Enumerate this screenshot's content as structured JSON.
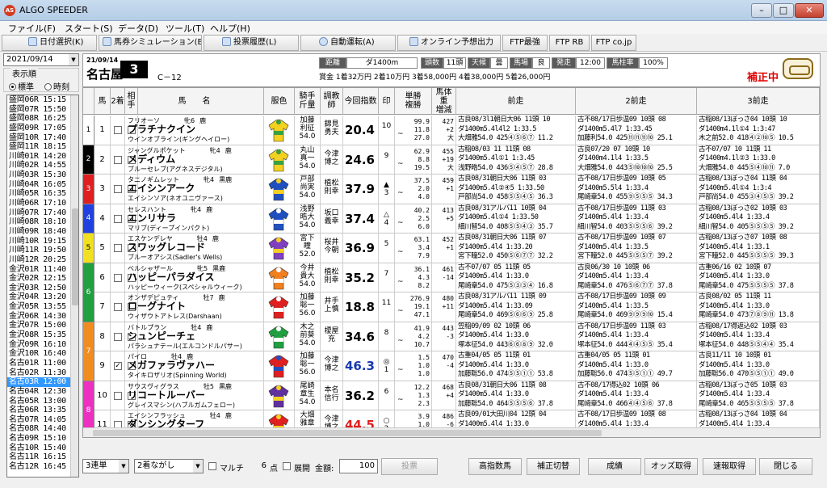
{
  "window": {
    "title": "ALGO SPEEDER",
    "app_icon_text": "AS",
    "minimize": "–",
    "maximize": "□",
    "close": "✕"
  },
  "menu": [
    "ファイル(F)",
    "スタート(S)",
    "データ(D)",
    "ツール(T)",
    "ヘルプ(H)"
  ],
  "toolbar": [
    "日付選択(K)",
    "馬券シミュレーション(B)",
    "投票履歴(L)",
    "自動運転(A)",
    "オンライン予想出力",
    "FTP最強",
    "FTP RB",
    "FTP co.jp"
  ],
  "left": {
    "date": "2021/09/14",
    "display_order_label": "表示順",
    "radio_standard": "標準",
    "radio_time": "時刻",
    "races": [
      "盛岡06R 15:15",
      "盛岡07R 15:50",
      "盛岡08R 16:25",
      "盛岡09R 17:05",
      "盛岡10R 17:40",
      "盛岡11R 18:15",
      "川崎01R 14:20",
      "川崎02R 14:55",
      "川崎03R 15:30",
      "川崎04R 16:05",
      "川崎05R 16:35",
      "川崎06R 17:10",
      "川崎07R 17:40",
      "川崎08R 18:10",
      "川崎09R 18:40",
      "川崎10R 19:15",
      "川崎11R 19:50",
      "川崎12R 20:25",
      "金沢01R 11:40",
      "金沢02R 12:15",
      "金沢03R 12:50",
      "金沢04R 13:20",
      "金沢05R 13:55",
      "金沢06R 14:30",
      "金沢07R 15:00",
      "金沢08R 15:35",
      "金沢09R 16:10",
      "金沢10R 16:40",
      "名古01R 11:00",
      "名古02R 11:30",
      "名古03R 12:00",
      "名古04R 12:30",
      "名古05R 13:00",
      "名古06R 13:35",
      "名古07R 14:05",
      "名古08R 14:40",
      "名古09R 15:10",
      "名古10R 15:40",
      "名古11R 16:15",
      "名古12R 16:45"
    ],
    "selected_index": 30
  },
  "header": {
    "date": "21/09/14",
    "venue": "名古屋",
    "race_no": "3",
    "class": "C－12",
    "distance_label": "距離",
    "distance": "ダ1400m",
    "count_label": "頭数",
    "count": "11頭",
    "weather_label": "天候",
    "weather": "曇",
    "track_label": "馬場",
    "track": "良",
    "post_label": "発走",
    "post_time": "12:00",
    "fav_label": "馬柱率",
    "fav_rate": "100%",
    "prize": "賞金 1着32万円 2着10万円 3着58,000円 4着38,000円 5着26,000円",
    "hosei": "補正中"
  },
  "columns": [
    "馬",
    "2着",
    "相手",
    "馬　　名",
    "服色",
    "騎手\n斤量",
    "調教\n師",
    "今回指数",
    "印",
    "単勝\n複勝",
    "馬体重\n増減",
    "前走",
    "2前走",
    "3前走"
  ],
  "horses": [
    {
      "waku": "1",
      "wcolor": "#ffffff",
      "wtext": "#000",
      "no": "1",
      "c2": false,
      "opp": false,
      "sire": "フリオーソ",
      "sex": "牝6",
      "color": "鹿",
      "name": "プラチナクイン",
      "pedigree": "ウインオブライン(ギングヘイロー)",
      "jockey": "加藤\n利征\n54.0",
      "trainer": "錦見\n勇夫",
      "index": "20.4",
      "icolor": "#000",
      "mark": "",
      "rank": "10",
      "tan": "99.9\n11.8\n27.0",
      "wt": "427\n+2\n大",
      "silk": [
        "#f4d020",
        "#3aa040"
      ],
      "p1": [
        "古良08/3l1朝日大06 11頭 10",
        "ダ1400m5.4l4l2 1:33.5",
        "大畑雅54.0 425④⑤⑥⑦ 11.2"
      ],
      "p2": [
        "古不08/17日歩温09 10頭 08",
        "ダ1400m5.4l7 1:33.45",
        "加藤利54.0 425⑪⑪⑪⑩ 25.1"
      ],
      "p3": [
        "古稲08/13ぼっさ04 10頭 10",
        "ダ1400m4.1l①4 1:3:47",
        "木之前52.0 418④②⑩⑤ 10.5"
      ]
    },
    {
      "waku": "2",
      "wcolor": "#000000",
      "wtext": "#fff",
      "no": "2",
      "c2": false,
      "opp": false,
      "sire": "ジャングルポケット",
      "sex": "牝4",
      "color": "鹿",
      "name": "メディウム",
      "pedigree": "ブルーセレブ(アグネスデジタル)",
      "jockey": "丸山\n真一\n54.0",
      "trainer": "今津\n博之",
      "index": "24.6",
      "icolor": "#000",
      "mark": "",
      "rank": "9",
      "tan": "62.9\n8.8\n19.5",
      "wt": "455\n+19\n大",
      "silk": [
        "#f4d020",
        "#3aa040"
      ],
      "p1": [
        "古稲08/03 11 11頭 08",
        "ダ1400m5.4l①1 1:3.45",
        "浅野晧54.0 436⑤④⑤⑦ 28.8"
      ],
      "p2": [
        "古良07/20 07 10頭 10",
        "ダ1400m4.1l4 1:33.5",
        "大畑雅54.0 443⑤⑩⑩⑩ 25.5"
      ],
      "p3": [
        "古不07/07 10 11頭 11",
        "ダ1400m4.1l②3 1:33.0",
        "大畑雅54.0 445⑤④⑩⑪ 7.0"
      ]
    },
    {
      "waku": "3",
      "wcolor": "#e02020",
      "wtext": "#fff",
      "no": "3",
      "c2": false,
      "opp": true,
      "sire": "タニノギムレット",
      "sex": "牝4",
      "color": "黒鹿",
      "name": "エイシンアーク",
      "pedigree": "エイシンソア(ネオユニヴァース)",
      "jockey": "戸部\n尚実\n54.0",
      "trainer": "植松\n則幸",
      "index": "37.9",
      "icolor": "#000",
      "mark": "▲",
      "rank": "3",
      "tan": "37.5\n2.0\n4.0",
      "wt": "459\n+1\n",
      "silk": [
        "#2050c0",
        "#f4d020"
      ],
      "p1": [
        "古良08/31朝日大06 11頭 03",
        "ダ1400m5.4l②④5 1:33.50",
        "戸部尚54.0 458⑤⑤④⑤ 36.3"
      ],
      "p2": [
        "古不08/17日歩温09 10頭 05",
        "ダ1400m5.5l4 1:33.4",
        "尾崎章54.0 455⑨⑤⑤⑤ 34.3"
      ],
      "p3": [
        "古稲08/13ぼっさ04 11頭 04",
        "ダ1400m5.4l①4 1:3:4",
        "戸部尚54.0 455③④⑤⑤ 39.2"
      ]
    },
    {
      "waku": "4",
      "wcolor": "#2040e0",
      "wtext": "#fff",
      "no": "4",
      "c2": false,
      "opp": true,
      "sire": "セレスハント",
      "sex": "牝4",
      "color": "鹿",
      "name": "エンリサラ",
      "pedigree": "マリブ(ディープインパクト)",
      "jockey": "浅野\n晧大\n54.0",
      "trainer": "坂口\n義幸",
      "index": "37.4",
      "icolor": "#000",
      "mark": "△",
      "rank": "4",
      "tan": "40.2\n2.5\n6.0",
      "wt": "413\n+5\n",
      "silk": [
        "#2050c0",
        "#ffffff"
      ],
      "p1": [
        "古良08/31アルバ11 10頭 04",
        "ダ1400m5.4l①4 1:33.50",
        "細川智54.0 408⑤⑤④③ 35.7"
      ],
      "p2": [
        "古不08/17日歩温09 11頭 03",
        "ダ1400m5.4l4 1:33.4",
        "細川智54.0 403⑤⑤⑤⑥ 39.2"
      ],
      "p3": [
        "古稲08/13ぼっさ02 10頭 03",
        "ダ1400m5.4l4 1:33.4",
        "細川智54.0 405⑤⑤⑤⑤ 39.2"
      ]
    },
    {
      "waku": "5",
      "wcolor": "#f0e020",
      "wtext": "#000",
      "no": "5",
      "c2": false,
      "opp": false,
      "sire": "エスケンデレヤ",
      "sex": "牡4",
      "color": "鹿",
      "name": "スワッグレコード",
      "pedigree": "ブルーオアシス(Sadler's Wells)",
      "jockey": "宮下\n瞳\n52.0",
      "trainer": "桜井\n今朝",
      "index": "36.9",
      "icolor": "#000",
      "mark": "",
      "rank": "5",
      "tan": "63.1\n3.4\n7.9",
      "wt": "452\n+1\n",
      "silk": [
        "#8040c0",
        "#f4d020"
      ],
      "p1": [
        "古良08/31朝日大06 11頭 07",
        "ダ1400m5.4l4 1:33.20",
        "宮下瞳52.0 450⑤⑥⑦⑦ 32.2"
      ],
      "p2": [
        "古不08/17日歩温09 10頭 07",
        "ダ1400m5.4l4 1:33.5",
        "宮下瞳52.0 445⑤⑤⑤⑦ 39.2"
      ],
      "p3": [
        "古稲08/13ぼっさ07 10頭 08",
        "ダ1400m5.4l4 1:33.1",
        "宮下瞳52.0 445⑤⑤⑤⑤ 39.3"
      ]
    },
    {
      "waku": "6",
      "wcolor": "#20a040",
      "wtext": "#fff",
      "no": "6",
      "c2": false,
      "opp": false,
      "sire": "ベルシャザール",
      "sex": "牝5",
      "color": "黒鹿",
      "name": "ハッピーパラダイス",
      "pedigree": "ハッピーウィーク(スペシャルウィーク)",
      "jockey": "今井\n貴大\n54.0",
      "trainer": "植松\n則幸",
      "index": "35.2",
      "icolor": "#000",
      "mark": "",
      "rank": "7",
      "tan": "36.1\n4.3\n8.2",
      "wt": "461\n-14\n",
      "silk": [
        "#f08020",
        "#ffffff"
      ],
      "p1": [
        "古不07/07 05 11頭 05",
        "ダ1400m5.4l4 1:33.0",
        "尾崎章54.0 475⑤③③④ 16.8"
      ],
      "p2": [
        "古良06/30 10 10頭 06",
        "ダ1400m5.4l4 1:33.4",
        "尾崎章54.0 476⑤⑥⑦⑦ 37.8"
      ],
      "p3": [
        "古重06/16 02 10頭 07",
        "ダ1400m5.4l4 1:33.0",
        "尾崎章54.0 475⑤⑤⑤⑤ 37.8"
      ]
    },
    {
      "waku": "6",
      "wcolor": "#20a040",
      "wtext": "#fff",
      "no": "7",
      "c2": false,
      "opp": false,
      "sire": "オンザデピュティ",
      "sex": "牡7",
      "color": "鹿",
      "name": "ローグナイト",
      "pedigree": "ウィザウトアトレス(Darshaan)",
      "jockey": "加藤\n聡一\n56.0",
      "trainer": "井手\n上慎",
      "index": "18.8",
      "icolor": "#000",
      "mark": "",
      "rank": "11",
      "tan": "276.9\n19.1\n47.1",
      "wt": "480\n+11\n",
      "silk": [
        "#e02020",
        "#ffffff"
      ],
      "p1": [
        "古良08/31アルバ11 11頭 09",
        "ダ1400m5.4l4 1:33.09",
        "尾崎章54.0 469⑤⑥⑥⑨ 25.8"
      ],
      "p2": [
        "古不08/17日歩温09 10頭 09",
        "ダ1400m5.4l4 1:33.5",
        "尾崎章54.0 469⑨⑨⑨⑩ 15.4"
      ],
      "p3": [
        "古良08/02 05 11頭 11",
        "ダ1400m5.4l4 1:33.0",
        "尾崎章54.0 473⑦⑧⑨⑪ 13.8"
      ]
    },
    {
      "waku": "7",
      "wcolor": "#f08c20",
      "wtext": "#fff",
      "no": "8",
      "c2": false,
      "opp": false,
      "sire": "バトルプラン",
      "sex": "牡4",
      "color": "鹿",
      "name": "シュンピーチェ",
      "pedigree": "パラシュナテール(エルコンドルパサー)",
      "jockey": "木之\n前葵\n54.0",
      "trainer": "榎屋\n充",
      "index": "34.6",
      "icolor": "#000",
      "mark": "",
      "rank": "8",
      "tan": "41.9\n4.2\n10.7",
      "wt": "443\n-3\n",
      "silk": [
        "#20a040",
        "#ffffff"
      ],
      "p1": [
        "笠稲09/09 02 10頭 06",
        "ダ1400m5.4l4 1:33.0",
        "塚本征54.0 443⑥⑥⑧⑨ 32.0"
      ],
      "p2": [
        "古不08/17日歩温09 11頭 03",
        "ダ1400m5.4l4 1:33.4",
        "塚本征54.0 444④④⑤⑤ 35.4"
      ],
      "p3": [
        "古稲08/17得返込02 10頭 03",
        "ダ1400m5.4l4 1:33.4",
        "塚本征54.0 448⑤⑤④④ 35.4"
      ]
    },
    {
      "waku": "7",
      "wcolor": "#f08c20",
      "wtext": "#fff",
      "no": "9",
      "c2": true,
      "opp": false,
      "sire": "パイロ",
      "sex": "牡4",
      "color": "鹿",
      "name": "メガファラヴァハー",
      "pedigree": "タイキロザリオ(Spinning World)",
      "jockey": "加藤\n聡一\n56.0",
      "trainer": "今津\n博之",
      "index": "46.3",
      "icolor": "#1a3ab0",
      "mark": "◎",
      "rank": "1",
      "tan": "1.5\n1.0\n1.0",
      "wt": "470\n-4\n",
      "silk": [
        "#e02020",
        "#2050c0"
      ],
      "p1": [
        "古重04/05 05 11頭 01",
        "ダ1400m5.4l4 1:33.0",
        "加藤聡56.0 474⑤⑤①① 53.8"
      ],
      "p2": [
        "古重04/05 05 11頭 01",
        "ダ1400m5.4l4 1:33.0",
        "加藤聡56.0 474⑤⑤①① 49.7"
      ],
      "p3": [
        "古良11/11 10 10頭 01",
        "ダ1400m5.4l4 1:33.0",
        "加藤聡56.0 470⑤⑤①① 49.0"
      ]
    },
    {
      "waku": "8",
      "wcolor": "#ee30c0",
      "wtext": "#fff",
      "no": "10",
      "c2": false,
      "opp": false,
      "sire": "サウスヴィグラス",
      "sex": "牡5",
      "color": "黒鹿",
      "name": "リコートルーバー",
      "pedigree": "グレイスマシン(ハブルガムフェロー)",
      "jockey": "尾崎\n章生\n54.0",
      "trainer": "本名\n信行",
      "index": "36.2",
      "icolor": "#000",
      "mark": "",
      "rank": "6",
      "tan": "12.2\n1.3\n2.3",
      "wt": "468\n+4\n",
      "silk": [
        "#6030a0",
        "#f4d020"
      ],
      "p1": [
        "古良08/31朝日大06 11頭 08",
        "ダ1400m5.4l4 1:33.0",
        "加藤聡54.0 464⑤⑤⑤⑥ 37.8"
      ],
      "p2": [
        "古不08/17得込02 10頭 06",
        "ダ1400m5.4l4 1:33.4",
        "尾崎章54.0 466④④⑤⑥ 37.8"
      ],
      "p3": [
        "古稲08/13ぼっさ05 10頭 03",
        "ダ1400m5.4l4 1:33.4",
        "尾崎章54.0 465⑤⑤⑤⑤ 37.8"
      ]
    },
    {
      "waku": "8",
      "wcolor": "#ee30c0",
      "wtext": "#fff",
      "no": "11",
      "c2": false,
      "opp": true,
      "sire": "エイシンフラッシュ",
      "sex": "牡4",
      "color": "鹿",
      "name": "ダンシングターフ",
      "pedigree": "キョウシュウエリ(ダンスインザダーク)",
      "jockey": "大畑\n雅章\n54.0",
      "trainer": "今津\n博之",
      "index": "44.5",
      "icolor": "#e02020",
      "mark": "○",
      "rank": "2",
      "tan": "3.9\n1.0\n1.3",
      "wt": "486\n-6\n",
      "silk": [
        "#e02020",
        "#f4d020"
      ],
      "p1": [
        "古良09/01大田川04 12頭 04",
        "ダ1400m5.4l4 1:33.0",
        "加藤聡54.0 483⑤⑤④④ 45.5"
      ],
      "p2": [
        "古不08/17日歩温09 10頭 08",
        "ダ1400m5.4l4 1:33.4",
        "加藤聡54.0 480⑤⑤④④ 45.5"
      ],
      "p3": [
        "古稲08/13ぼっさ04 10頭 04",
        "ダ1400m5.4l4 1:33.4",
        "加藤聡54.0 482⑤⑤④④ 45.5"
      ]
    }
  ],
  "bottom": {
    "bet_type": "3連単",
    "bet_mode": "2着ながし",
    "multi": "マルチ",
    "points_value": "6",
    "points_unit": "点",
    "spread": "展開",
    "amount_label": "金額:",
    "amount_value": "100",
    "amount_unit": "円",
    "buttons": [
      "投票",
      "高指数馬",
      "補正切替",
      "成績",
      "オッズ取得",
      "速報取得",
      "閉じる"
    ]
  },
  "colors": {
    "accent_red": "#e00000",
    "selected": "#3399ff"
  }
}
